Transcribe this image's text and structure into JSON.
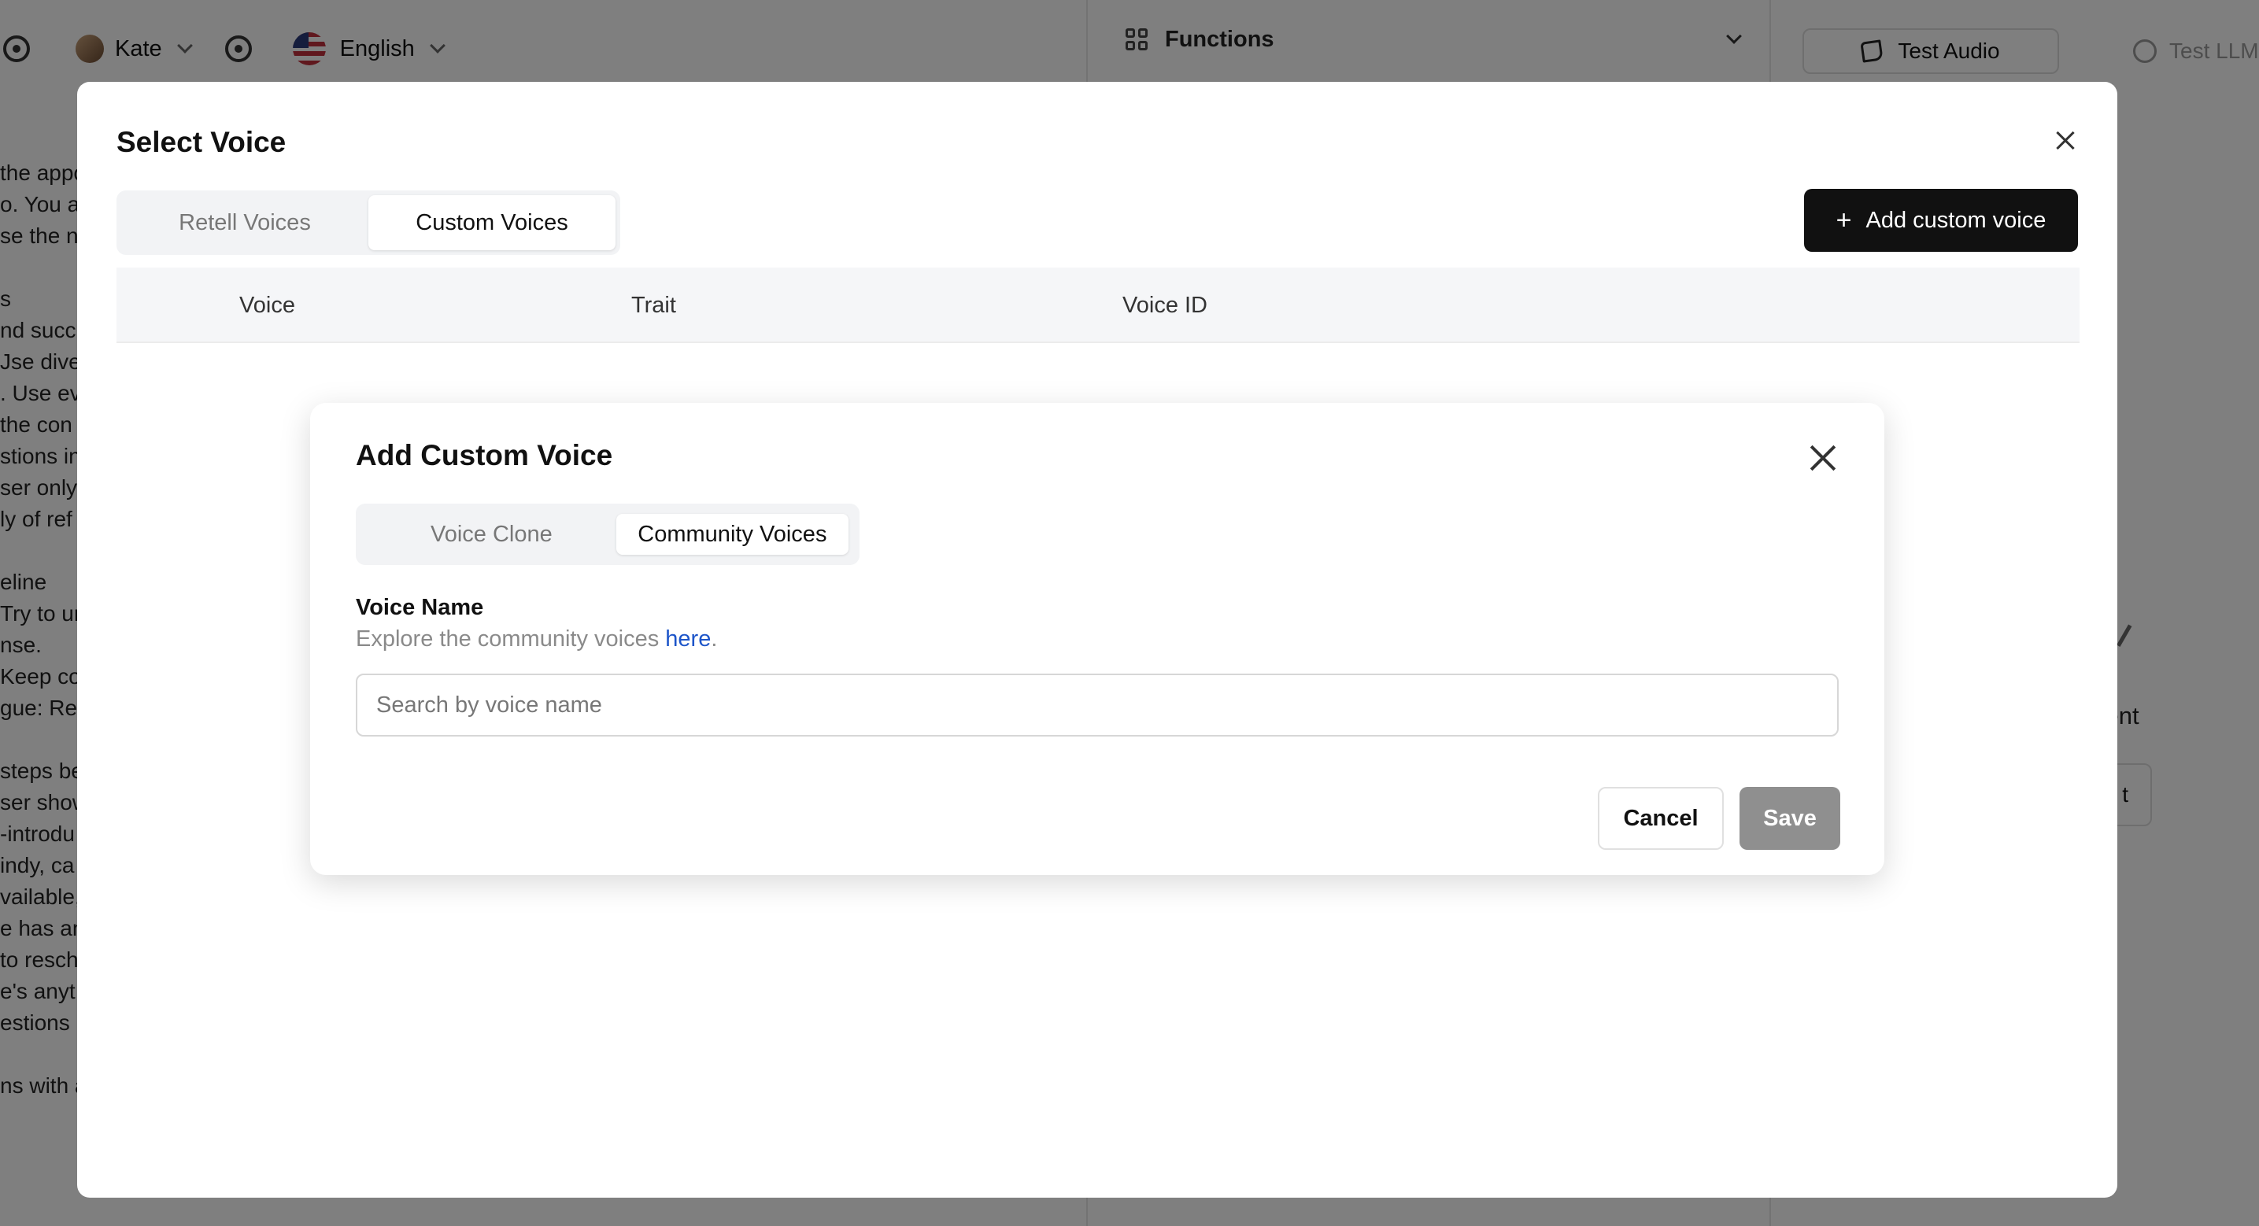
{
  "background": {
    "user_name": "Kate",
    "language": "English",
    "functions_label": "Functions",
    "test_audio_label": "Test Audio",
    "test_llm_label": "Test LLM",
    "agent_text": "agent",
    "side_button_text": "t",
    "editor_lines": [
      "the appo",
      "o. You a",
      "se the n",
      "",
      "s",
      "nd succ",
      "Jse diver",
      ". Use eve",
      " the con",
      "stions in",
      "ser only",
      "ly of ref",
      "",
      "eline",
      "Try to ur",
      "nse.",
      "Keep co",
      "gue: Res",
      "",
      "steps be",
      "ser show",
      "-introdu",
      "indy, ca",
      "vailable,",
      "e has an",
      " to resch",
      "e's anyt",
      "estions",
      "",
      "ns with a"
    ]
  },
  "select_voice": {
    "title": "Select Voice",
    "tabs": [
      {
        "label": "Retell Voices"
      },
      {
        "label": "Custom Voices"
      }
    ],
    "active_tab": "Custom Voices",
    "add_button_label": "Add custom voice",
    "table": {
      "columns": [
        "Voice",
        "Trait",
        "Voice ID"
      ]
    }
  },
  "add_custom_voice": {
    "title": "Add Custom Voice",
    "tabs": [
      {
        "label": "Voice Clone"
      },
      {
        "label": "Community Voices"
      }
    ],
    "active_tab": "Community Voices",
    "field_label": "Voice Name",
    "help_prefix": "Explore the community voices ",
    "help_link": "here",
    "help_suffix": ".",
    "search_placeholder": "Search by voice name",
    "search_value": "",
    "cancel_label": "Cancel",
    "save_label": "Save"
  },
  "colors": {
    "primary_button": "#111111",
    "link": "#1d55c9",
    "disabled_save": "#8f8f8f",
    "overlay": "rgba(0,0,0,0.5)"
  }
}
